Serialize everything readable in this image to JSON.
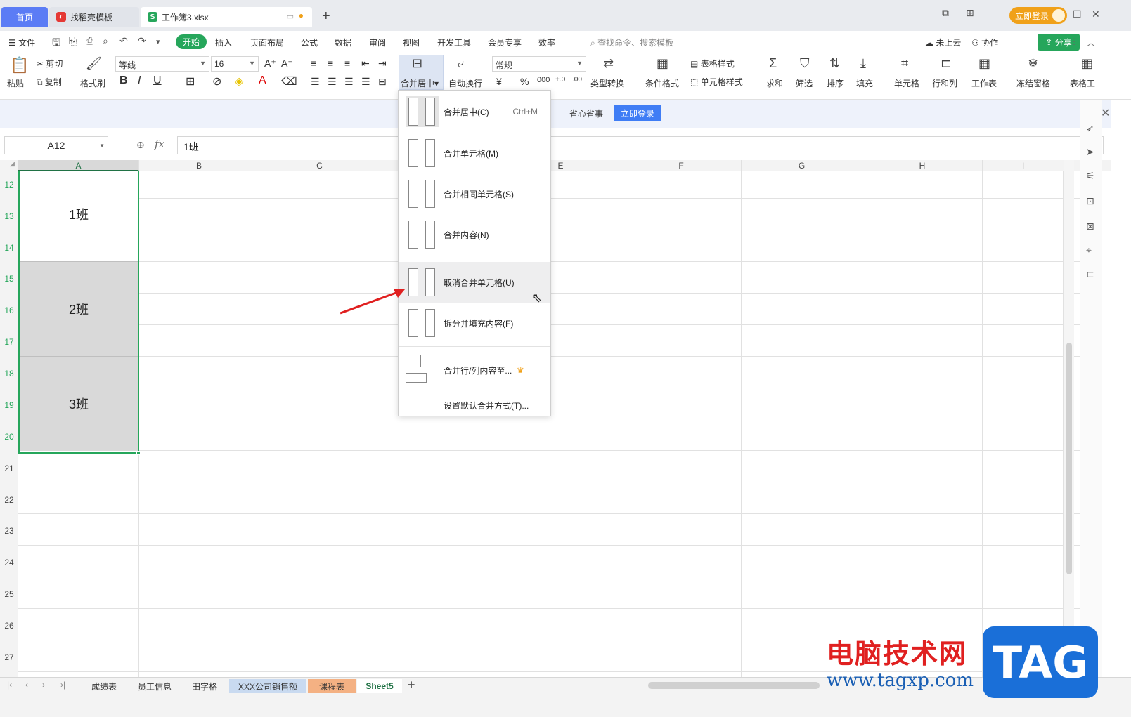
{
  "titlebar": {
    "tabs": [
      {
        "label": "首页"
      },
      {
        "label": "找稻壳模板"
      },
      {
        "label": "工作簿3.xlsx"
      }
    ],
    "login_label": "立即登录"
  },
  "menubar": {
    "file": "文件",
    "items": [
      "开始",
      "插入",
      "页面布局",
      "公式",
      "数据",
      "审阅",
      "视图",
      "开发工具",
      "会员专享",
      "效率"
    ],
    "search_placeholder": "查找命令、搜索模板",
    "cloud": "未上云",
    "collab": "协作",
    "share": "分享"
  },
  "ribbon": {
    "paste": "粘贴",
    "cut": "剪切",
    "copy": "复制",
    "format_painter": "格式刷",
    "font_name": "等线",
    "font_size": "16",
    "merge_center": "合并居中",
    "wrap_text": "自动换行",
    "number_format": "常规",
    "type_convert": "类型转换",
    "cond_format": "条件格式",
    "table_style": "表格样式",
    "cell_style": "单元格样式",
    "sum": "求和",
    "filter": "筛选",
    "sort": "排序",
    "fill": "填充",
    "cell": "单元格",
    "row_col": "行和列",
    "worksheet": "工作表",
    "freeze": "冻结窗格",
    "table_tools": "表格工"
  },
  "notice": {
    "text": "省心省事",
    "button": "立即登录"
  },
  "formula": {
    "name_box": "A12",
    "fx": "fx",
    "value": "1班"
  },
  "columns": [
    "A",
    "B",
    "C",
    "D",
    "E",
    "F",
    "G",
    "H",
    "I"
  ],
  "rows": [
    "12",
    "13",
    "14",
    "15",
    "16",
    "17",
    "18",
    "19",
    "20",
    "21",
    "22",
    "23",
    "24",
    "25",
    "26",
    "27"
  ],
  "cells": {
    "merged1": "1班",
    "merged2": "2班",
    "merged3": "3班"
  },
  "dropdown": {
    "items": [
      {
        "label": "合并居中(C)",
        "shortcut": "Ctrl+M"
      },
      {
        "label": "合并单元格(M)"
      },
      {
        "label": "合并相同单元格(S)"
      },
      {
        "label": "合并内容(N)"
      },
      {
        "label": "取消合并单元格(U)"
      },
      {
        "label": "拆分并填充内容(F)"
      },
      {
        "label": "合并行/列内容至..."
      },
      {
        "label": "设置默认合并方式(T)..."
      }
    ]
  },
  "sheets": [
    "成绩表",
    "员工信息",
    "田字格",
    "XXX公司销售额",
    "课程表",
    "Sheet5"
  ],
  "watermark": {
    "text": "电脑技术网",
    "url": "www.tagxp.com",
    "logo": "TAG"
  },
  "colors": {
    "accent_green": "#26a65b",
    "tab_blue": "#5b7cf5",
    "login_orange": "#f0a11a",
    "selection_green": "#26a65b",
    "arrow_red": "#e02020"
  }
}
